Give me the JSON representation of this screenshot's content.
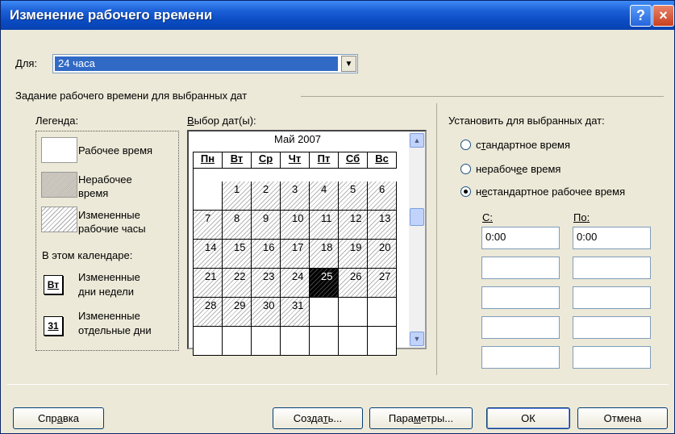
{
  "window": {
    "title": "Изменение рабочего времени",
    "help_glyph": "?",
    "close_glyph": "×"
  },
  "for_field": {
    "label_u": "Д",
    "label_rest": "ля:",
    "value": "24 часа",
    "arrow": "▼"
  },
  "group_title": "Задание рабочего времени для выбранных дат",
  "legend": {
    "title": "Легенда:",
    "working": "Рабочее время",
    "nonworking_1": "Нерабочее",
    "nonworking_2": "время",
    "edited_1": "Измененные",
    "edited_2": "рабочие часы",
    "in_calendar": "В этом календаре:",
    "edited_days_icon": "Вт",
    "edited_days_1": "Измененные",
    "edited_days_2": "дни недели",
    "edited_dates_icon": "31",
    "edited_dates_1": "Измененные",
    "edited_dates_2": "отдельные дни"
  },
  "calendar": {
    "label_u": "В",
    "label_rest": "ыбор дат(ы):",
    "month": "Май 2007",
    "weekdays": [
      "Пн",
      "Вт",
      "Ср",
      "Чт",
      "Пт",
      "Сб",
      "Вс"
    ],
    "rows": [
      [
        "",
        "1",
        "2",
        "3",
        "4",
        "5",
        "6"
      ],
      [
        "7",
        "8",
        "9",
        "10",
        "11",
        "12",
        "13"
      ],
      [
        "14",
        "15",
        "16",
        "17",
        "18",
        "19",
        "20"
      ],
      [
        "21",
        "22",
        "23",
        "24",
        "25",
        "26",
        "27"
      ],
      [
        "28",
        "29",
        "30",
        "31",
        "",
        "",
        ""
      ],
      [
        "",
        "",
        "",
        "",
        "",
        "",
        ""
      ]
    ],
    "selected": "25",
    "scroll_up": "▲",
    "scroll_down": "▼"
  },
  "set_for": {
    "title": "Установить для выбранных дат:",
    "options": [
      {
        "pre": "с",
        "u": "т",
        "post": "андартное время",
        "checked": false
      },
      {
        "pre": "нерабоч",
        "u": "е",
        "post": "е время",
        "checked": false
      },
      {
        "pre": "н",
        "u": "е",
        "post": "стандартное рабочее время",
        "checked": true
      }
    ],
    "from_label": "С:",
    "to_label": "По:",
    "from_values": [
      "0:00",
      "",
      "",
      "",
      ""
    ],
    "to_values": [
      "0:00",
      "",
      "",
      "",
      ""
    ]
  },
  "buttons": {
    "help": {
      "pre": "Спр",
      "u": "а",
      "post": "вка"
    },
    "create": {
      "pre": "Созда",
      "u": "т",
      "post": "ь..."
    },
    "params": {
      "pre": "Пара",
      "u": "м",
      "post": "етры..."
    },
    "ok": "ОК",
    "cancel": "Отмена"
  },
  "colors": {
    "titlebar": "#0a4bc2",
    "dialog_bg": "#ece9d8",
    "selection": "#316ac5"
  }
}
